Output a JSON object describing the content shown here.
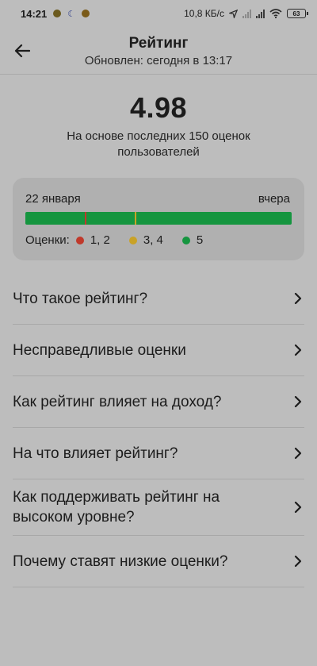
{
  "status_bar": {
    "time": "14:21",
    "network_speed": "10,8 КБ/с",
    "battery": "63",
    "notif_colors": [
      "#6b5a1e",
      "#2a3a8a",
      "#7a5a18"
    ]
  },
  "header": {
    "title": "Рейтинг",
    "subtitle": "Обновлен: сегодня в 13:17",
    "back_icon": "arrow-left-icon"
  },
  "rating": {
    "value": "4.98",
    "description": "На основе последних 150 оценок пользователей"
  },
  "timeline": {
    "start_label": "22 января",
    "end_label": "вчера",
    "bar_color": "#15953f",
    "marks": [
      {
        "position": 0.222,
        "color": "#c0392b"
      },
      {
        "position": 0.41,
        "color": "#c9a227"
      }
    ],
    "legend_label": "Оценки:",
    "legend": [
      {
        "label": "1, 2",
        "color": "#c0392b"
      },
      {
        "label": "3, 4",
        "color": "#c9a227"
      },
      {
        "label": "5",
        "color": "#15953f"
      }
    ]
  },
  "faq": [
    {
      "label": "Что такое рейтинг?"
    },
    {
      "label": "Несправедливые оценки"
    },
    {
      "label": "Как рейтинг влияет на доход?"
    },
    {
      "label": "На что влияет рейтинг?"
    },
    {
      "label": "Как поддерживать рейтинг на высоком уровне?"
    },
    {
      "label": "Почему ставят низкие оценки?"
    }
  ]
}
